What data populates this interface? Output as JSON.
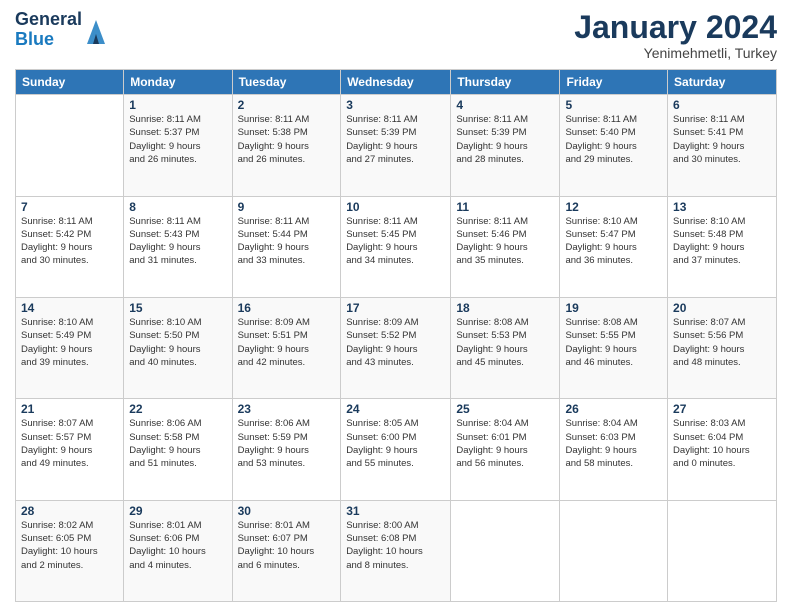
{
  "header": {
    "logo_general": "General",
    "logo_blue": "Blue",
    "month_title": "January 2024",
    "location": "Yenimehmetli, Turkey"
  },
  "columns": [
    "Sunday",
    "Monday",
    "Tuesday",
    "Wednesday",
    "Thursday",
    "Friday",
    "Saturday"
  ],
  "weeks": [
    [
      {
        "day": "",
        "info": ""
      },
      {
        "day": "1",
        "info": "Sunrise: 8:11 AM\nSunset: 5:37 PM\nDaylight: 9 hours\nand 26 minutes."
      },
      {
        "day": "2",
        "info": "Sunrise: 8:11 AM\nSunset: 5:38 PM\nDaylight: 9 hours\nand 26 minutes."
      },
      {
        "day": "3",
        "info": "Sunrise: 8:11 AM\nSunset: 5:39 PM\nDaylight: 9 hours\nand 27 minutes."
      },
      {
        "day": "4",
        "info": "Sunrise: 8:11 AM\nSunset: 5:39 PM\nDaylight: 9 hours\nand 28 minutes."
      },
      {
        "day": "5",
        "info": "Sunrise: 8:11 AM\nSunset: 5:40 PM\nDaylight: 9 hours\nand 29 minutes."
      },
      {
        "day": "6",
        "info": "Sunrise: 8:11 AM\nSunset: 5:41 PM\nDaylight: 9 hours\nand 30 minutes."
      }
    ],
    [
      {
        "day": "7",
        "info": "Sunrise: 8:11 AM\nSunset: 5:42 PM\nDaylight: 9 hours\nand 30 minutes."
      },
      {
        "day": "8",
        "info": "Sunrise: 8:11 AM\nSunset: 5:43 PM\nDaylight: 9 hours\nand 31 minutes."
      },
      {
        "day": "9",
        "info": "Sunrise: 8:11 AM\nSunset: 5:44 PM\nDaylight: 9 hours\nand 33 minutes."
      },
      {
        "day": "10",
        "info": "Sunrise: 8:11 AM\nSunset: 5:45 PM\nDaylight: 9 hours\nand 34 minutes."
      },
      {
        "day": "11",
        "info": "Sunrise: 8:11 AM\nSunset: 5:46 PM\nDaylight: 9 hours\nand 35 minutes."
      },
      {
        "day": "12",
        "info": "Sunrise: 8:10 AM\nSunset: 5:47 PM\nDaylight: 9 hours\nand 36 minutes."
      },
      {
        "day": "13",
        "info": "Sunrise: 8:10 AM\nSunset: 5:48 PM\nDaylight: 9 hours\nand 37 minutes."
      }
    ],
    [
      {
        "day": "14",
        "info": "Sunrise: 8:10 AM\nSunset: 5:49 PM\nDaylight: 9 hours\nand 39 minutes."
      },
      {
        "day": "15",
        "info": "Sunrise: 8:10 AM\nSunset: 5:50 PM\nDaylight: 9 hours\nand 40 minutes."
      },
      {
        "day": "16",
        "info": "Sunrise: 8:09 AM\nSunset: 5:51 PM\nDaylight: 9 hours\nand 42 minutes."
      },
      {
        "day": "17",
        "info": "Sunrise: 8:09 AM\nSunset: 5:52 PM\nDaylight: 9 hours\nand 43 minutes."
      },
      {
        "day": "18",
        "info": "Sunrise: 8:08 AM\nSunset: 5:53 PM\nDaylight: 9 hours\nand 45 minutes."
      },
      {
        "day": "19",
        "info": "Sunrise: 8:08 AM\nSunset: 5:55 PM\nDaylight: 9 hours\nand 46 minutes."
      },
      {
        "day": "20",
        "info": "Sunrise: 8:07 AM\nSunset: 5:56 PM\nDaylight: 9 hours\nand 48 minutes."
      }
    ],
    [
      {
        "day": "21",
        "info": "Sunrise: 8:07 AM\nSunset: 5:57 PM\nDaylight: 9 hours\nand 49 minutes."
      },
      {
        "day": "22",
        "info": "Sunrise: 8:06 AM\nSunset: 5:58 PM\nDaylight: 9 hours\nand 51 minutes."
      },
      {
        "day": "23",
        "info": "Sunrise: 8:06 AM\nSunset: 5:59 PM\nDaylight: 9 hours\nand 53 minutes."
      },
      {
        "day": "24",
        "info": "Sunrise: 8:05 AM\nSunset: 6:00 PM\nDaylight: 9 hours\nand 55 minutes."
      },
      {
        "day": "25",
        "info": "Sunrise: 8:04 AM\nSunset: 6:01 PM\nDaylight: 9 hours\nand 56 minutes."
      },
      {
        "day": "26",
        "info": "Sunrise: 8:04 AM\nSunset: 6:03 PM\nDaylight: 9 hours\nand 58 minutes."
      },
      {
        "day": "27",
        "info": "Sunrise: 8:03 AM\nSunset: 6:04 PM\nDaylight: 10 hours\nand 0 minutes."
      }
    ],
    [
      {
        "day": "28",
        "info": "Sunrise: 8:02 AM\nSunset: 6:05 PM\nDaylight: 10 hours\nand 2 minutes."
      },
      {
        "day": "29",
        "info": "Sunrise: 8:01 AM\nSunset: 6:06 PM\nDaylight: 10 hours\nand 4 minutes."
      },
      {
        "day": "30",
        "info": "Sunrise: 8:01 AM\nSunset: 6:07 PM\nDaylight: 10 hours\nand 6 minutes."
      },
      {
        "day": "31",
        "info": "Sunrise: 8:00 AM\nSunset: 6:08 PM\nDaylight: 10 hours\nand 8 minutes."
      },
      {
        "day": "",
        "info": ""
      },
      {
        "day": "",
        "info": ""
      },
      {
        "day": "",
        "info": ""
      }
    ]
  ]
}
